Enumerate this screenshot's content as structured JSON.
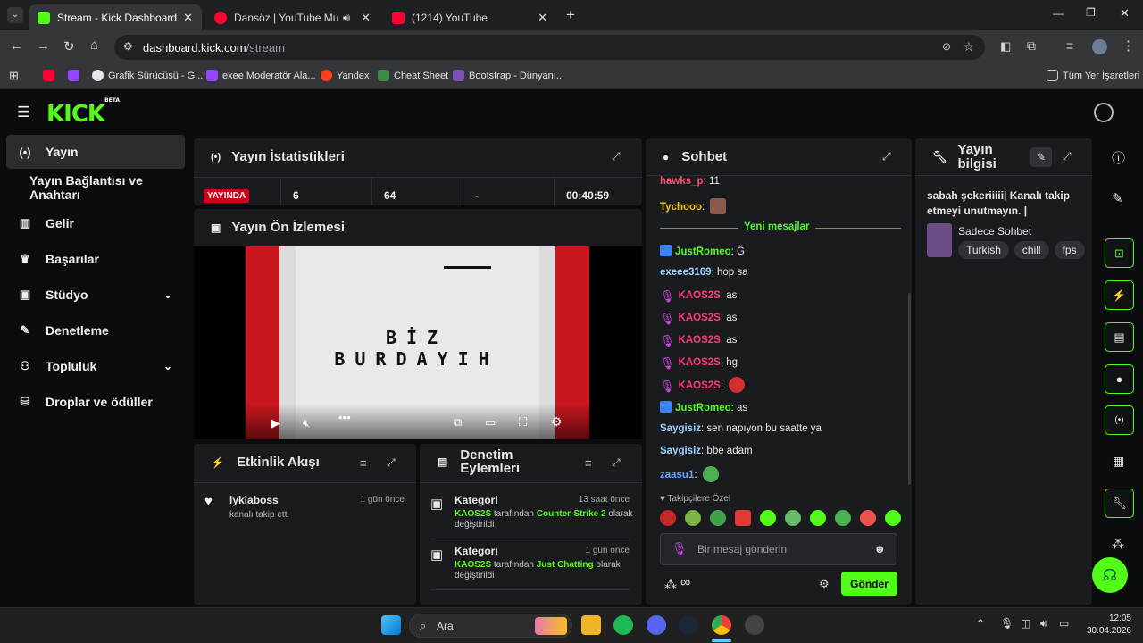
{
  "browser": {
    "tabs": [
      {
        "title": "Stream - Kick Dashboard",
        "color": "#53fc18"
      },
      {
        "title": "Dansöz | YouTube Music",
        "color": "#ff0033"
      },
      {
        "title": "(1214) YouTube",
        "color": "#ff0033"
      }
    ],
    "url_host": "dashboard.kick.com",
    "url_path": "/stream",
    "bookmarks": [
      "Grafik Sürücüsü - G...",
      "exee Moderatör Ala...",
      "Yandex",
      "Cheat Sheet",
      "Bootstrap - Dünyanı..."
    ],
    "all_bookmarks": "Tüm Yer İşaretleri"
  },
  "app": {
    "logo": "KICK",
    "logo_badge": "BETA",
    "accent": "#53fc18",
    "sidebar": [
      {
        "label": "Yayın",
        "icon": "broadcast-icon"
      },
      {
        "label": "Yayın Bağlantısı ve Anahtarı",
        "icon": ""
      },
      {
        "label": "Gelir",
        "icon": "chart-icon"
      },
      {
        "label": "Başarılar",
        "icon": "trophy-icon"
      },
      {
        "label": "Stüdyo",
        "icon": "studio-icon"
      },
      {
        "label": "Denetleme",
        "icon": "wrench-icon"
      },
      {
        "label": "Topluluk",
        "icon": "community-icon"
      },
      {
        "label": "Droplar ve ödüller",
        "icon": "drops-icon"
      }
    ],
    "stats": {
      "title": "Yayın İstatistikleri",
      "live": "YAYINDA",
      "values": [
        "6",
        "64",
        "-",
        "00:40:59"
      ]
    },
    "preview": {
      "title": "Yayın Ön İzlemesi",
      "overlay_text": "BİZ BURDAYIH"
    },
    "activity": {
      "title": "Etkinlik Akışı",
      "items": [
        {
          "user": "lykiaboss",
          "text": "kanalı takip etti",
          "time": "1 gün önce"
        }
      ]
    },
    "moderation": {
      "title": "Denetim Eylemleri",
      "items": [
        {
          "type": "Kategori",
          "time": "13 saat önce",
          "user": "KAOS2S",
          "mid": "tarafından",
          "cat": "Counter-Strike 2",
          "end": "olarak değiştirildi"
        },
        {
          "type": "Kategori",
          "time": "1 gün önce",
          "user": "KAOS2S",
          "mid": "tarafından",
          "cat": "Just Chatting",
          "end": "olarak değiştirildi"
        }
      ]
    },
    "chat": {
      "title": "Sohbet",
      "new_messages": "Yeni mesajlar",
      "messages": [
        {
          "user": "hawks_p",
          "text": "11",
          "color": "#ff4d6d"
        },
        {
          "user": "Tychooo",
          "text": "",
          "color": "#f1c40f"
        },
        {
          "user": "JustRomeo",
          "text": "Ğ",
          "color": "#53fc18"
        },
        {
          "user": "exeee3169",
          "text": "hop sa",
          "color": "#9fd3ff"
        },
        {
          "user": "KAOS2S",
          "text": "as",
          "color": "#ff3b7f"
        },
        {
          "user": "KAOS2S",
          "text": "as",
          "color": "#ff3b7f"
        },
        {
          "user": "KAOS2S",
          "text": "as",
          "color": "#ff3b7f"
        },
        {
          "user": "KAOS2S",
          "text": "hg",
          "color": "#ff3b7f"
        },
        {
          "user": "KAOS2S",
          "text": "",
          "color": "#ff3b7f"
        },
        {
          "user": "JustRomeo",
          "text": "as",
          "color": "#53fc18"
        },
        {
          "user": "Saygisiz",
          "text": "sen napıyon bu saatte ya",
          "color": "#9fd3ff"
        },
        {
          "user": "Saygisiz",
          "text": "bbe adam",
          "color": "#9fd3ff"
        },
        {
          "user": "zaasu1",
          "text": "",
          "color": "#6ba4ff"
        }
      ],
      "followers_only": "Takipçilere Özel",
      "placeholder": "Bir mesaj gönderin",
      "send": "Gönder"
    },
    "info": {
      "title": "Yayın bilgisi",
      "stream_title": "sabah şekeriiiii| Kanalı takip etmeyi unutmayın. |",
      "category": "Sadece Sohbet",
      "tags": [
        "Turkish",
        "chill",
        "fps"
      ]
    }
  },
  "taskbar": {
    "search": "Ara",
    "time": "12:05",
    "date": "30.04.2026"
  }
}
